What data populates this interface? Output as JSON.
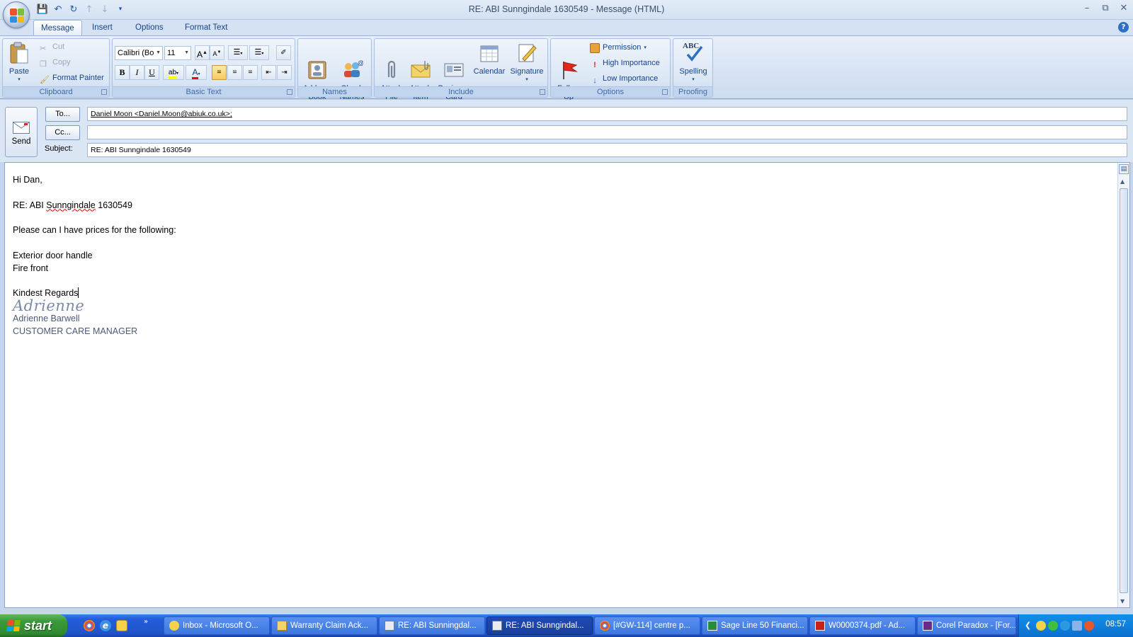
{
  "window": {
    "title": "RE: ABI Sunngindale 1630549 - Message (HTML)"
  },
  "ribbon_tabs": [
    {
      "label": "Message",
      "active": true
    },
    {
      "label": "Insert",
      "active": false
    },
    {
      "label": "Options",
      "active": false
    },
    {
      "label": "Format Text",
      "active": false
    }
  ],
  "clipboard": {
    "paste_label": "Paste",
    "cut_label": "Cut",
    "copy_label": "Copy",
    "format_painter_label": "Format Painter",
    "group_label": "Clipboard"
  },
  "basic_text": {
    "font_name": "Calibri (Bo",
    "font_size": "11",
    "group_label": "Basic Text",
    "bold_label": "B",
    "italic_label": "I",
    "underline_label": "U",
    "grow_font_label": "A",
    "shrink_font_label": "A",
    "highlight_label": "ab",
    "font_color_label": "A",
    "highlight_color": "#ffff00",
    "font_color": "#ff0000"
  },
  "names": {
    "address_book_label": "Address\nBook",
    "check_names_label": "Check\nNames",
    "group_label": "Names"
  },
  "include": {
    "attach_file_label": "Attach\nFile",
    "attach_item_label": "Attach\nItem",
    "business_card_label": "Business\nCard",
    "calendar_label": "Calendar",
    "signature_label": "Signature",
    "group_label": "Include"
  },
  "options": {
    "follow_up_label": "Follow\nUp",
    "permission_label": "Permission",
    "high_importance_label": "High Importance",
    "low_importance_label": "Low Importance",
    "group_label": "Options"
  },
  "proofing": {
    "spelling_label": "Spelling",
    "abc_label": "ABC",
    "group_label": "Proofing"
  },
  "header": {
    "send_label": "Send",
    "to_button": "To...",
    "cc_button": "Cc...",
    "subject_label": "Subject:",
    "to_value": "Daniel Moon <Daniel.Moon@abiuk.co.uk>;",
    "cc_value": "",
    "subject_value": "RE: ABI Sunngindale 1630549"
  },
  "body": {
    "greeting": "Hi Dan,",
    "ref_prefix": "RE: ABI ",
    "ref_misspelled": "Sunngindale",
    "ref_suffix": " 1630549",
    "request": "Please can I have prices for the following:",
    "item_1": "Exterior door handle",
    "item_2": "Fire front",
    "closing": "Kindest Regards",
    "signature_script": "Adrienne",
    "signature_name": "Adrienne Barwell",
    "signature_title": "CUSTOMER CARE MANAGER"
  },
  "taskbar": {
    "start_label": "start",
    "items": [
      {
        "label": "Inbox - Microsoft O...",
        "active": false
      },
      {
        "label": "Warranty Claim Ack...",
        "active": false
      },
      {
        "label": "RE: ABI Sunningdal...",
        "active": false
      },
      {
        "label": "RE: ABI Sunngindal...",
        "active": true
      },
      {
        "label": "[#GW-114] centre p...",
        "active": false
      },
      {
        "label": "Sage Line 50 Financi...",
        "active": false
      },
      {
        "label": "W0000374.pdf - Ad...",
        "active": false
      },
      {
        "label": "Corel Paradox - [For...",
        "active": false
      }
    ],
    "clock": "08:57"
  }
}
